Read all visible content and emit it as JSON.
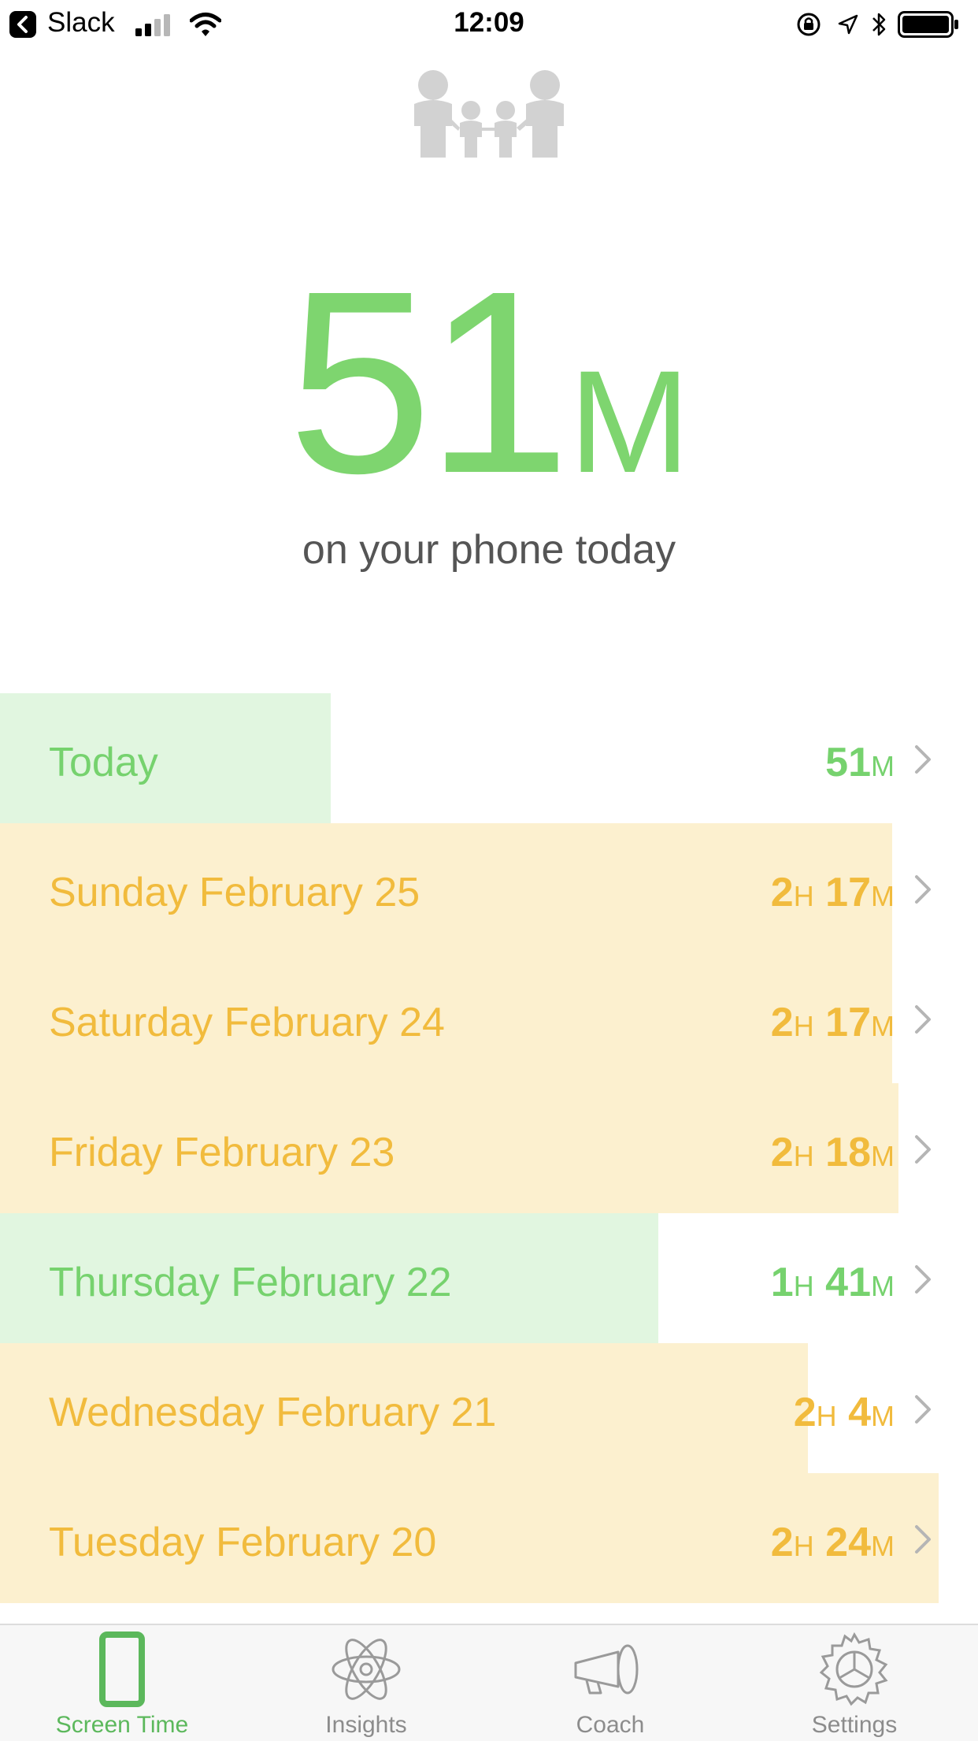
{
  "status_bar": {
    "back_app": "Slack",
    "time": "12:09",
    "icons": [
      "back-arrow-icon",
      "signal-icon",
      "wifi-icon",
      "orientation-lock-icon",
      "location-icon",
      "bluetooth-icon",
      "battery-icon"
    ]
  },
  "header": {
    "icon": "family-icon",
    "total_number": "51",
    "total_unit": "M",
    "subtitle": "on your phone today"
  },
  "colors": {
    "green": "#7ed56f",
    "green_bg": "#e1f6e0",
    "yellow": "#f1bb3d",
    "yellow_bg": "#fcf0cf",
    "tab_active": "#5cb85c",
    "tab_inactive": "#8c8c8c"
  },
  "days": [
    {
      "label": "Today",
      "h": "",
      "m": "51",
      "fill": 0.338,
      "status": "green"
    },
    {
      "label": "Sunday February 25",
      "h": "2",
      "m": "17",
      "fill": 0.912,
      "status": "yellow"
    },
    {
      "label": "Saturday February 24",
      "h": "2",
      "m": "17",
      "fill": 0.912,
      "status": "yellow"
    },
    {
      "label": "Friday February 23",
      "h": "2",
      "m": "18",
      "fill": 0.919,
      "status": "yellow"
    },
    {
      "label": "Thursday February 22",
      "h": "1",
      "m": "41",
      "fill": 0.673,
      "status": "green"
    },
    {
      "label": "Wednesday February 21",
      "h": "2",
      "m": "4",
      "fill": 0.826,
      "status": "yellow"
    },
    {
      "label": "Tuesday February 20",
      "h": "2",
      "m": "24",
      "fill": 0.96,
      "status": "yellow"
    }
  ],
  "units": {
    "hours": "H",
    "minutes": "M"
  },
  "tabs": [
    {
      "label": "Screen Time",
      "icon": "phone-icon",
      "active": true
    },
    {
      "label": "Insights",
      "icon": "atom-icon",
      "active": false
    },
    {
      "label": "Coach",
      "icon": "megaphone-icon",
      "active": false
    },
    {
      "label": "Settings",
      "icon": "gear-icon",
      "active": false
    }
  ]
}
